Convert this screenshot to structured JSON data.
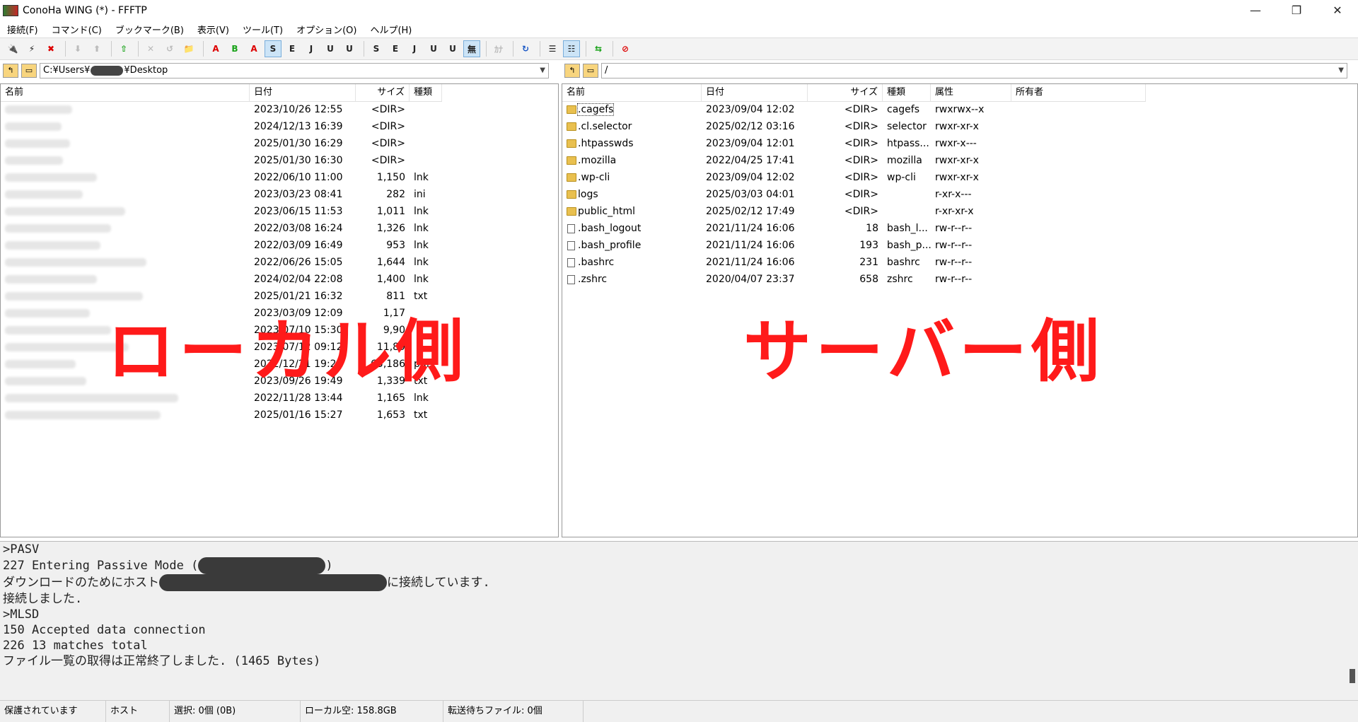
{
  "window": {
    "title": "ConoHa WING (*) - FFFTP",
    "minimize": "—",
    "maximize": "❐",
    "close": "✕"
  },
  "menu": [
    "接続(F)",
    "コマンド(C)",
    "ブックマーク(B)",
    "表示(V)",
    "ツール(T)",
    "オプション(O)",
    "ヘルプ(H)"
  ],
  "toolbar": [
    {
      "name": "connect-icon",
      "glyph": "🔌",
      "style": "red"
    },
    {
      "name": "quick-connect-icon",
      "glyph": "⚡",
      "style": ""
    },
    {
      "name": "disconnect-icon",
      "glyph": "✖",
      "style": "red"
    },
    {
      "sep": true
    },
    {
      "name": "download-icon",
      "glyph": "⬇",
      "style": "dis"
    },
    {
      "name": "upload-icon",
      "glyph": "⬆",
      "style": "dis"
    },
    {
      "sep": true
    },
    {
      "name": "mirror-upload-icon",
      "glyph": "⇧",
      "style": "green"
    },
    {
      "sep": true
    },
    {
      "name": "delete-icon",
      "glyph": "✕",
      "style": "dis"
    },
    {
      "name": "rename-icon",
      "glyph": "↺",
      "style": "dis"
    },
    {
      "name": "new-folder-icon",
      "glyph": "📁",
      "style": ""
    },
    {
      "sep": true
    },
    {
      "name": "ascii-mode-icon",
      "glyph": "A",
      "style": "red"
    },
    {
      "name": "binary-mode-icon",
      "glyph": "B",
      "style": "green"
    },
    {
      "name": "auto-mode-icon",
      "glyph": "A",
      "style": "red"
    },
    {
      "name": "host-kanji-sjis-icon",
      "glyph": "S",
      "style": "active"
    },
    {
      "name": "host-kanji-euc-icon",
      "glyph": "E",
      "style": ""
    },
    {
      "name": "host-kanji-jis-icon",
      "glyph": "J",
      "style": ""
    },
    {
      "name": "host-kanji-utf8n-icon",
      "glyph": "U",
      "style": ""
    },
    {
      "name": "host-kanji-utf8-icon",
      "glyph": "U",
      "style": ""
    },
    {
      "sep": true
    },
    {
      "name": "local-kanji-sjis-icon",
      "glyph": "S",
      "style": ""
    },
    {
      "name": "local-kanji-euc-icon",
      "glyph": "E",
      "style": ""
    },
    {
      "name": "local-kanji-jis-icon",
      "glyph": "J",
      "style": ""
    },
    {
      "name": "local-kanji-utf8n-icon",
      "glyph": "U",
      "style": ""
    },
    {
      "name": "local-kanji-utf8-icon",
      "glyph": "U",
      "style": ""
    },
    {
      "name": "no-conversion-icon",
      "glyph": "無",
      "style": "active"
    },
    {
      "sep": true
    },
    {
      "name": "kana-conversion-icon",
      "glyph": "ｶﾅ",
      "style": "dis"
    },
    {
      "sep": true
    },
    {
      "name": "refresh-icon",
      "glyph": "↻",
      "style": "blue"
    },
    {
      "sep": true
    },
    {
      "name": "list-view-icon",
      "glyph": "☰",
      "style": ""
    },
    {
      "name": "detail-view-icon",
      "glyph": "☷",
      "style": "active"
    },
    {
      "sep": true
    },
    {
      "name": "sync-dir-icon",
      "glyph": "⇆",
      "style": "green"
    },
    {
      "sep": true
    },
    {
      "name": "stop-icon",
      "glyph": "⊘",
      "style": "red"
    }
  ],
  "local": {
    "path_before": "C:¥Users¥",
    "path_after": "¥Desktop",
    "headers": {
      "name": "名前",
      "date": "日付",
      "size": "サイズ",
      "type": "種類"
    },
    "files": [
      {
        "name": "[unclear]",
        "date": "2023/10/26 12:55",
        "size": "<DIR>",
        "type": "",
        "folder": true
      },
      {
        "name": "[unclear]",
        "date": "2024/12/13 16:39",
        "size": "<DIR>",
        "type": "",
        "folder": true
      },
      {
        "name": "[unclear]",
        "date": "2025/01/30 16:29",
        "size": "<DIR>",
        "type": "",
        "folder": true
      },
      {
        "name": "[unclear]",
        "date": "2025/01/30 16:30",
        "size": "<DIR>",
        "type": "",
        "folder": true
      },
      {
        "name": "[unclear]",
        "date": "2022/06/10 11:00",
        "size": "1,150",
        "type": "lnk",
        "folder": false
      },
      {
        "name": "[unclear]",
        "date": "2023/03/23 08:41",
        "size": "282",
        "type": "ini",
        "folder": false
      },
      {
        "name": "[unclear]",
        "date": "2023/06/15 11:53",
        "size": "1,011",
        "type": "lnk",
        "folder": false
      },
      {
        "name": "[unclear]",
        "date": "2022/03/08 16:24",
        "size": "1,326",
        "type": "lnk",
        "folder": false
      },
      {
        "name": "[unclear]",
        "date": "2022/03/09 16:49",
        "size": "953",
        "type": "lnk",
        "folder": false
      },
      {
        "name": "[unclear]",
        "date": "2022/06/26 15:05",
        "size": "1,644",
        "type": "lnk",
        "folder": false
      },
      {
        "name": "[unclear]",
        "date": "2024/02/04 22:08",
        "size": "1,400",
        "type": "lnk",
        "folder": false
      },
      {
        "name": "[unclear]",
        "date": "2025/01/21 16:32",
        "size": "811",
        "type": "txt",
        "folder": false
      },
      {
        "name": "[unclear]",
        "date": "2023/03/09 12:09",
        "size": "1,17",
        "type": "",
        "folder": false
      },
      {
        "name": "[unclear]",
        "date": "2023/07/10 15:30",
        "size": "9,90",
        "type": "",
        "folder": false
      },
      {
        "name": "[unclear]",
        "date": "2023/07/12 09:12",
        "size": "11,89",
        "type": "",
        "folder": false
      },
      {
        "name": "[unclear]",
        "date": "2022/12/21 19:29",
        "size": "65,186",
        "type": "pdf",
        "folder": false
      },
      {
        "name": "[unclear]",
        "date": "2023/09/26 19:49",
        "size": "1,339",
        "type": "txt",
        "folder": false
      },
      {
        "name": "[unclear]",
        "date": "2022/11/28 13:44",
        "size": "1,165",
        "type": "lnk",
        "folder": false
      },
      {
        "name": "[unclear]",
        "date": "2025/01/16 15:27",
        "size": "1,653",
        "type": "txt",
        "folder": false
      }
    ],
    "overlay_label": "ローカル側"
  },
  "remote": {
    "path": "/",
    "headers": {
      "name": "名前",
      "date": "日付",
      "size": "サイズ",
      "type": "種類",
      "attr": "属性",
      "owner": "所有者"
    },
    "files": [
      {
        "name": ".cagefs",
        "date": "2023/09/04 12:02",
        "size": "<DIR>",
        "type": "cagefs",
        "attr": "rwxrwx--x",
        "folder": true
      },
      {
        "name": ".cl.selector",
        "date": "2025/02/12 03:16",
        "size": "<DIR>",
        "type": "selector",
        "attr": "rwxr-xr-x",
        "folder": true
      },
      {
        "name": ".htpasswds",
        "date": "2023/09/04 12:01",
        "size": "<DIR>",
        "type": "htpass...",
        "attr": "rwxr-x---",
        "folder": true
      },
      {
        "name": ".mozilla",
        "date": "2022/04/25 17:41",
        "size": "<DIR>",
        "type": "mozilla",
        "attr": "rwxr-xr-x",
        "folder": true
      },
      {
        "name": ".wp-cli",
        "date": "2023/09/04 12:02",
        "size": "<DIR>",
        "type": "wp-cli",
        "attr": "rwxr-xr-x",
        "folder": true
      },
      {
        "name": "logs",
        "date": "2025/03/03 04:01",
        "size": "<DIR>",
        "type": "",
        "attr": "r-xr-x---",
        "folder": true
      },
      {
        "name": "public_html",
        "date": "2025/02/12 17:49",
        "size": "<DIR>",
        "type": "",
        "attr": "r-xr-xr-x",
        "folder": true
      },
      {
        "name": ".bash_logout",
        "date": "2021/11/24 16:06",
        "size": "18",
        "type": "bash_l...",
        "attr": "rw-r--r--",
        "folder": false
      },
      {
        "name": ".bash_profile",
        "date": "2021/11/24 16:06",
        "size": "193",
        "type": "bash_p...",
        "attr": "rw-r--r--",
        "folder": false
      },
      {
        "name": ".bashrc",
        "date": "2021/11/24 16:06",
        "size": "231",
        "type": "bashrc",
        "attr": "rw-r--r--",
        "folder": false
      },
      {
        "name": ".zshrc",
        "date": "2020/04/07 23:37",
        "size": "658",
        "type": "zshrc",
        "attr": "rw-r--r--",
        "folder": false
      }
    ],
    "overlay_label": "サーバー側"
  },
  "log": {
    "l1": ">PASV",
    "l2_pre": "227 Entering Passive Mode (",
    "l2_post": ")",
    "l3_pre": "ダウンロードのためにホスト",
    "l3_post": "に接続しています.",
    "l4": "接続しました.",
    "l5": ">MLSD",
    "l6": "150 Accepted data connection",
    "l7": "226 13 matches total",
    "l8": "ファイル一覧の取得は正常終了しました. (1465 Bytes)"
  },
  "status": {
    "protection": "保護されています",
    "host": "ホスト",
    "selection": "選択: 0個 (0B)",
    "local_free": "ローカル空: 158.8GB",
    "queue": "転送待ちファイル: 0個"
  }
}
